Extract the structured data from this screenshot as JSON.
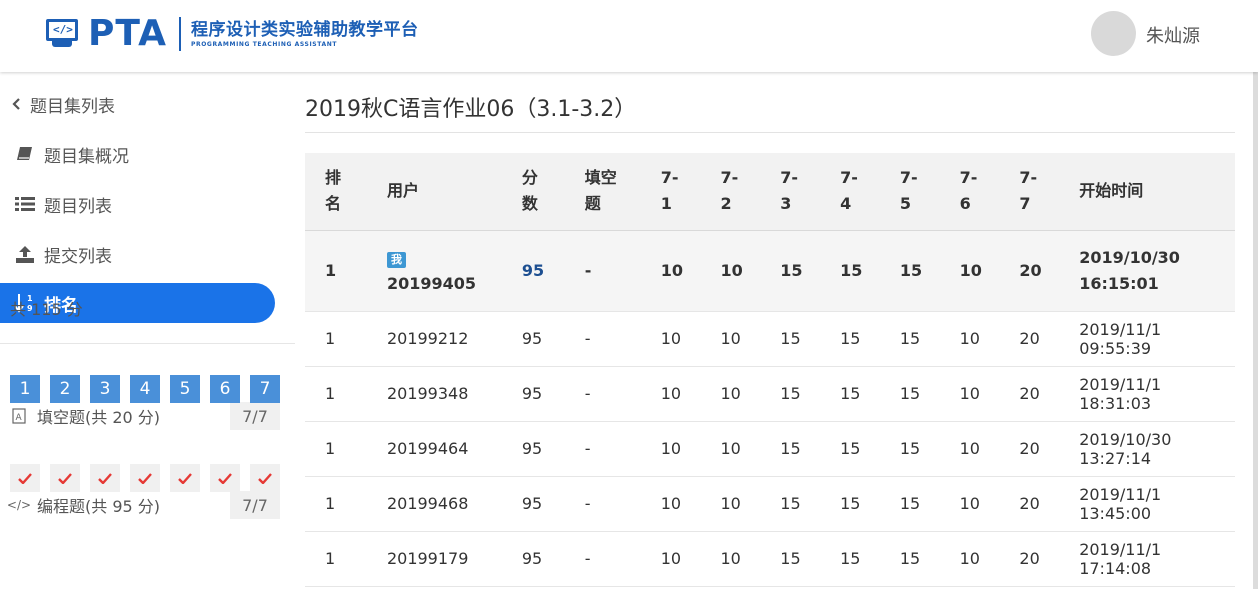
{
  "header": {
    "logo_text": "PTA",
    "logo_cn": "程序设计类实验辅助教学平台",
    "logo_en": "PROGRAMMING TEACHING ASSISTANT",
    "user_name": "朱灿源"
  },
  "sidebar": {
    "back_label": "题目集列表",
    "items": [
      {
        "label": "题目集概况",
        "icon": "book-icon"
      },
      {
        "label": "题目列表",
        "icon": "list-icon"
      },
      {
        "label": "提交列表",
        "icon": "upload-icon"
      },
      {
        "label": "排名",
        "icon": "sort-numeric-icon",
        "active": true
      }
    ],
    "total_score": "共 115 分",
    "sections": [
      {
        "label": "填空题(共 20 分)",
        "icon": "fill-blank-icon",
        "count": "7/7",
        "problems": [
          "1",
          "2",
          "3",
          "4",
          "5",
          "6",
          "7"
        ]
      },
      {
        "label": "编程题(共 95 分)",
        "icon": "code-icon",
        "count": "7/7",
        "problems_solved": 7
      }
    ]
  },
  "main": {
    "title": "2019秋C语言作业06（3.1-3.2）",
    "columns": [
      "排名",
      "用户",
      "分数",
      "填空题",
      "7-1",
      "7-2",
      "7-3",
      "7-4",
      "7-5",
      "7-6",
      "7-7",
      "开始时间"
    ],
    "my_badge": "我",
    "rows": [
      {
        "rank": "1",
        "user": "20199405",
        "score": "95",
        "fill": "-",
        "p1": "10",
        "p2": "10",
        "p3": "15",
        "p4": "15",
        "p5": "15",
        "p6": "10",
        "p7": "20",
        "start": "2019/10/30 16:15:01",
        "is_me": true
      },
      {
        "rank": "1",
        "user": "20199212",
        "score": "95",
        "fill": "-",
        "p1": "10",
        "p2": "10",
        "p3": "15",
        "p4": "15",
        "p5": "15",
        "p6": "10",
        "p7": "20",
        "start": "2019/11/1 09:55:39"
      },
      {
        "rank": "1",
        "user": "20199348",
        "score": "95",
        "fill": "-",
        "p1": "10",
        "p2": "10",
        "p3": "15",
        "p4": "15",
        "p5": "15",
        "p6": "10",
        "p7": "20",
        "start": "2019/11/1 18:31:03"
      },
      {
        "rank": "1",
        "user": "20199464",
        "score": "95",
        "fill": "-",
        "p1": "10",
        "p2": "10",
        "p3": "15",
        "p4": "15",
        "p5": "15",
        "p6": "10",
        "p7": "20",
        "start": "2019/10/30 13:27:14"
      },
      {
        "rank": "1",
        "user": "20199468",
        "score": "95",
        "fill": "-",
        "p1": "10",
        "p2": "10",
        "p3": "15",
        "p4": "15",
        "p5": "15",
        "p6": "10",
        "p7": "20",
        "start": "2019/11/1 13:45:00"
      },
      {
        "rank": "1",
        "user": "20199179",
        "score": "95",
        "fill": "-",
        "p1": "10",
        "p2": "10",
        "p3": "15",
        "p4": "15",
        "p5": "15",
        "p6": "10",
        "p7": "20",
        "start": "2019/11/1 17:14:08"
      }
    ]
  },
  "colors": {
    "accent": "#1a73e8",
    "brand": "#1d5fb5",
    "problem_box": "#4a90d9",
    "check": "#e53935"
  }
}
